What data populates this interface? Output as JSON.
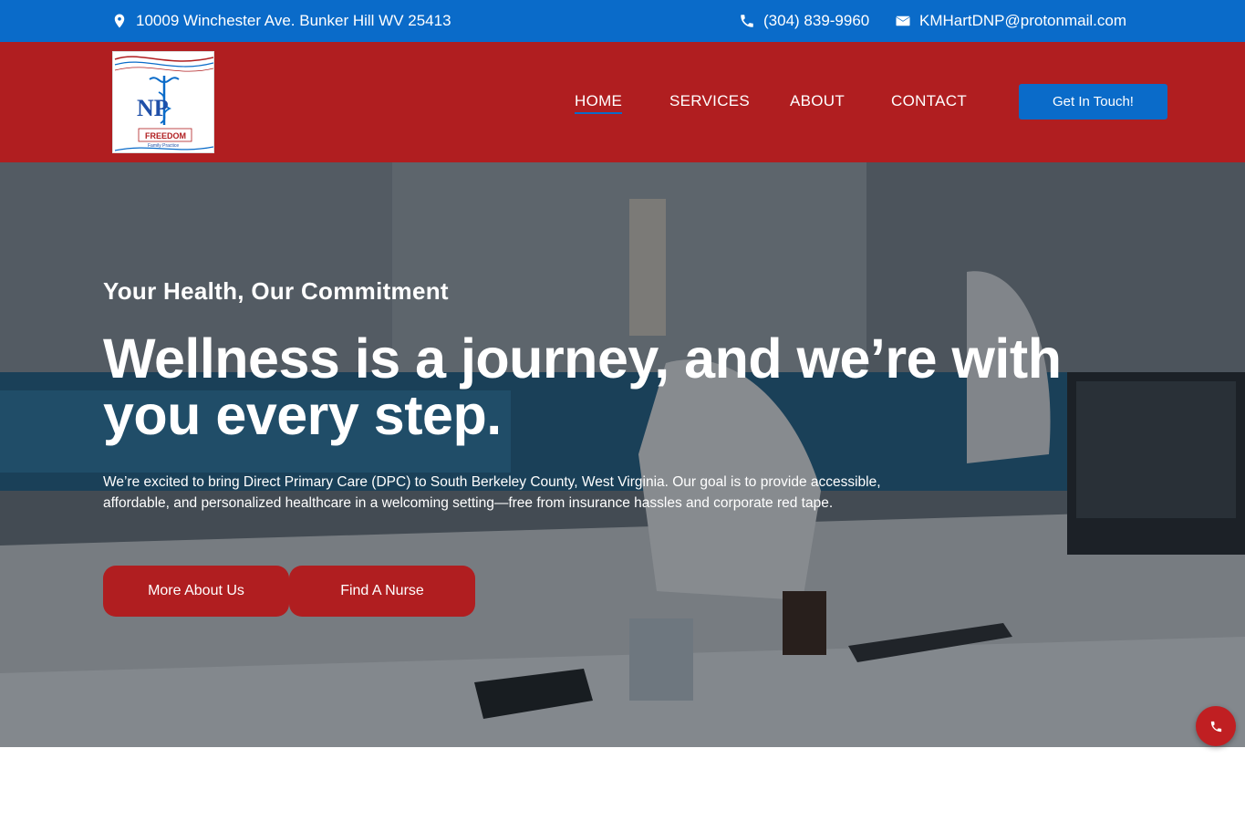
{
  "topbar": {
    "address": "10009 Winchester Ave. Bunker Hill WV 25413",
    "phone": "(304) 839-9960",
    "email": "KMHartDNP@protonmail.com"
  },
  "header": {
    "logo_text_np": "NP",
    "logo_text_freedom": "FREEDOM",
    "logo_text_sub": "Family Practice",
    "nav": {
      "home": "HOME",
      "services": "SERVICES",
      "about": "ABOUT",
      "contact": "CONTACT"
    },
    "cta_label": "Get In Touch!"
  },
  "hero": {
    "subtitle": "Your Health, Our Commitment",
    "headline": "Wellness is a journey, and we’re with you every step.",
    "description": "We’re excited to bring Direct Primary Care (DPC) to South Berkeley County, West Virginia. Our goal is to provide accessible, affordable, and personalized healthcare in a welcoming setting—free from insurance hassles and corporate red tape.",
    "button_about": "More About Us",
    "button_nurse": "Find A Nurse"
  },
  "colors": {
    "topbar": "#0a6bc9",
    "header": "#b01e20",
    "accent_blue": "#0a6bc9",
    "button_red": "#b01e20"
  },
  "icons": {
    "address": "map-pin-icon",
    "phone": "phone-icon",
    "email": "envelope-icon",
    "floating": "phone-icon"
  }
}
